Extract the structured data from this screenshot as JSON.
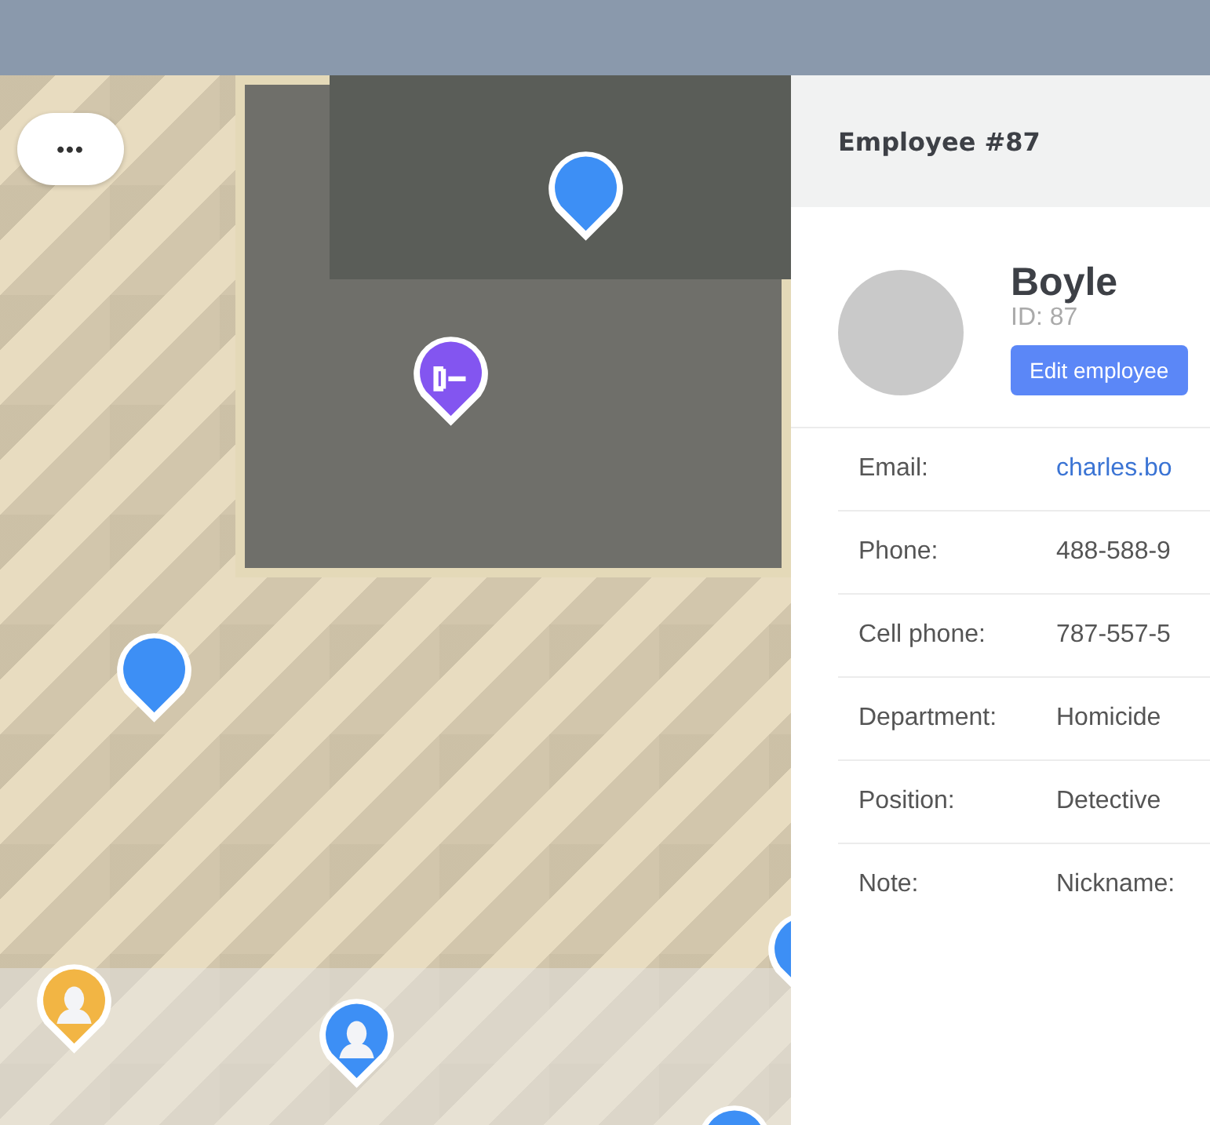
{
  "map": {
    "menu_button": "•••",
    "pins": [
      {
        "kind": "plain",
        "color": "#3d8ff5"
      },
      {
        "kind": "door",
        "color": "#8355f0"
      },
      {
        "kind": "plain",
        "color": "#3d8ff5"
      },
      {
        "kind": "person",
        "color": "#f2b544"
      },
      {
        "kind": "person",
        "color": "#3d8ff5"
      },
      {
        "kind": "plain",
        "color": "#3d8ff5"
      },
      {
        "kind": "plain",
        "color": "#3d8ff5"
      }
    ]
  },
  "panel": {
    "title": "Employee #87",
    "name": "Boyle",
    "id_text": "ID: 87",
    "edit_button": "Edit employee",
    "fields": [
      {
        "label": "Email:",
        "value": "charles.bo",
        "kind": "link"
      },
      {
        "label": "Phone:",
        "value": "488-588-9",
        "kind": "text"
      },
      {
        "label": "Cell phone:",
        "value": "787-557-5",
        "kind": "text"
      },
      {
        "label": "Department:",
        "value": "Homicide",
        "kind": "text"
      },
      {
        "label": "Position:",
        "value": "Detective",
        "kind": "text"
      },
      {
        "label": "Note:",
        "value": "Nickname:",
        "kind": "text"
      }
    ]
  }
}
